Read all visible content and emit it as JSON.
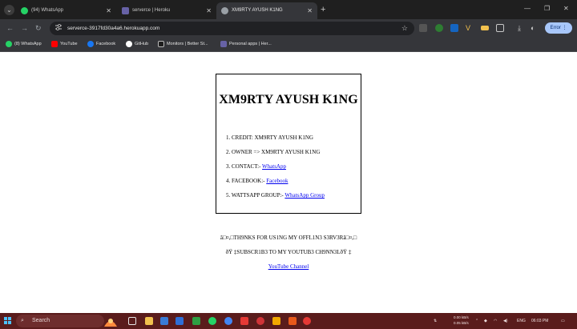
{
  "browser": {
    "tabs": [
      {
        "title": "(94) WhatsApp",
        "favicon_color": "#25d366",
        "active": false
      },
      {
        "title": "serverce | Heroku",
        "favicon_color": "#6762a6",
        "active": false
      },
      {
        "title": "XM9RTY AYUSH K1NG",
        "favicon_color": "#9aa0a6",
        "active": true
      }
    ],
    "new_tab_symbol": "+",
    "url": "serverce-3917fd30a4a6.herokuapp.com",
    "profile_label": "Error"
  },
  "bookmarks": [
    {
      "label": "(8) WhatsApp",
      "color": "#25d366"
    },
    {
      "label": "YouTube",
      "color": "#ff0000"
    },
    {
      "label": "Facebook",
      "color": "#1877f2"
    },
    {
      "label": "GitHub",
      "color": "#ffffff"
    },
    {
      "label": "Monitors | Better St...",
      "color": "#1e1e1e"
    },
    {
      "label": "Personal apps | Her...",
      "color": "#6762a6"
    }
  ],
  "page": {
    "title": "XM9RTY AYUSH K1NG",
    "items": [
      {
        "text": "1. CREDIT: XM9RTY AYUSH K1NG",
        "link": ""
      },
      {
        "text": "2. OWNER => XM9RTY AYUSH K1NG",
        "link": ""
      },
      {
        "text": "3. CONTACT:- ",
        "link": "WhatsApp"
      },
      {
        "text": "4. FACEBOOK:- ",
        "link": "Facebook"
      },
      {
        "text": "5. WATTSAPP GROUP:- ",
        "link": "WhatsApp Group"
      }
    ],
    "thanks_line": "â□¤,□TH9NKS FOR US1NG MY OFFL1N3 S3RV3Râ□¤,□",
    "subscribe_line": "ðŸ ‡SUBSCR1B3 TO MY YOUTUB3 CH9NN3LðŸ ‡",
    "youtube_link": "YouTube Channel"
  },
  "taskbar": {
    "search_placeholder": "Search",
    "net_up": "0.00 kB/s",
    "net_down": "0.05 kB/s",
    "language": "ENG",
    "time": "06:03 PM",
    "icon_colors": [
      "#e6e6e6",
      "#f2c14e",
      "#3a7bd5",
      "#2f6fd6",
      "#2ea043",
      "#25d366",
      "#4285f4",
      "#e53935",
      "#d13438",
      "#f2a900",
      "#e8591a"
    ]
  }
}
